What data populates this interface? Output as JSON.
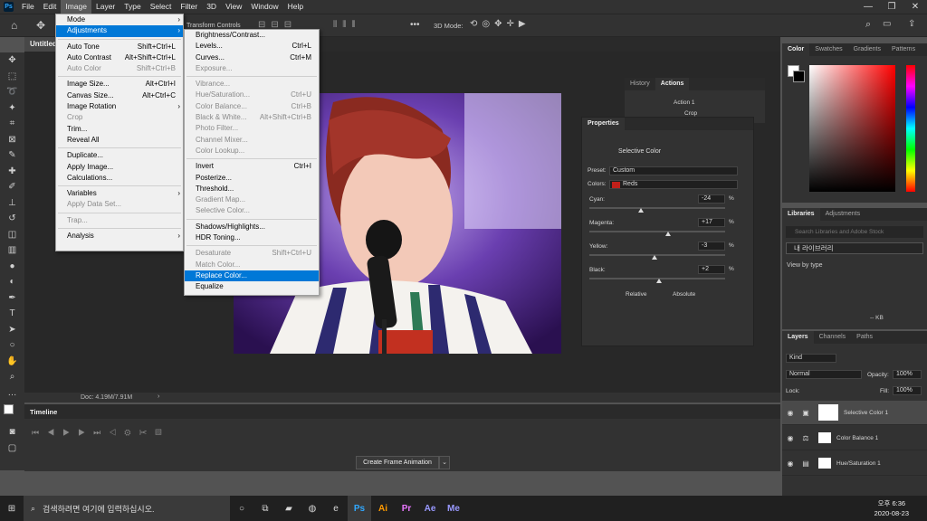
{
  "app": {
    "logo": "Ps"
  },
  "menubar": [
    "File",
    "Edit",
    "Image",
    "Layer",
    "Type",
    "Select",
    "Filter",
    "3D",
    "View",
    "Window",
    "Help"
  ],
  "window_controls": [
    "—",
    "❐",
    "✕"
  ],
  "options_bar": {
    "transform_label": "Transform Controls",
    "mode_3d": "3D Mode:",
    "dots": "•••"
  },
  "document": {
    "tab": "Untitled",
    "status": "Doc: 4.19M/7.91M"
  },
  "image_menu": [
    {
      "label": "Mode",
      "arrow": "›"
    },
    {
      "label": "Adjustments",
      "arrow": "›",
      "hl": true
    },
    {
      "sep": true
    },
    {
      "label": "Auto Tone",
      "sc": "Shift+Ctrl+L"
    },
    {
      "label": "Auto Contrast",
      "sc": "Alt+Shift+Ctrl+L"
    },
    {
      "label": "Auto Color",
      "sc": "Shift+Ctrl+B",
      "dis": true
    },
    {
      "sep": true
    },
    {
      "label": "Image Size...",
      "sc": "Alt+Ctrl+I"
    },
    {
      "label": "Canvas Size...",
      "sc": "Alt+Ctrl+C"
    },
    {
      "label": "Image Rotation",
      "arrow": "›"
    },
    {
      "label": "Crop",
      "dis": true
    },
    {
      "label": "Trim..."
    },
    {
      "label": "Reveal All"
    },
    {
      "sep": true
    },
    {
      "label": "Duplicate..."
    },
    {
      "label": "Apply Image..."
    },
    {
      "label": "Calculations..."
    },
    {
      "sep": true
    },
    {
      "label": "Variables",
      "arrow": "›"
    },
    {
      "label": "Apply Data Set...",
      "dis": true
    },
    {
      "sep": true
    },
    {
      "label": "Trap...",
      "dis": true
    },
    {
      "sep": true
    },
    {
      "label": "Analysis",
      "arrow": "›"
    }
  ],
  "adjust_menu": [
    {
      "label": "Brightness/Contrast..."
    },
    {
      "label": "Levels...",
      "sc": "Ctrl+L"
    },
    {
      "label": "Curves...",
      "sc": "Ctrl+M"
    },
    {
      "label": "Exposure...",
      "dis": true
    },
    {
      "sep": true
    },
    {
      "label": "Vibrance...",
      "dis": true
    },
    {
      "label": "Hue/Saturation...",
      "sc": "Ctrl+U",
      "dis": true
    },
    {
      "label": "Color Balance...",
      "sc": "Ctrl+B",
      "dis": true
    },
    {
      "label": "Black & White...",
      "sc": "Alt+Shift+Ctrl+B",
      "dis": true
    },
    {
      "label": "Photo Filter...",
      "dis": true
    },
    {
      "label": "Channel Mixer...",
      "dis": true
    },
    {
      "label": "Color Lookup...",
      "dis": true
    },
    {
      "sep": true
    },
    {
      "label": "Invert",
      "sc": "Ctrl+I"
    },
    {
      "label": "Posterize..."
    },
    {
      "label": "Threshold..."
    },
    {
      "label": "Gradient Map...",
      "dis": true
    },
    {
      "label": "Selective Color...",
      "dis": true
    },
    {
      "sep": true
    },
    {
      "label": "Shadows/Highlights..."
    },
    {
      "label": "HDR Toning..."
    },
    {
      "sep": true
    },
    {
      "label": "Desaturate",
      "sc": "Shift+Ctrl+U",
      "dis": true
    },
    {
      "label": "Match Color...",
      "dis": true
    },
    {
      "label": "Replace Color...",
      "hl": true
    },
    {
      "label": "Equalize"
    }
  ],
  "history_panel": {
    "tabs": [
      "History",
      "Actions"
    ],
    "items": [
      "Action 1",
      "Crop"
    ]
  },
  "properties": {
    "tab": "Properties",
    "title": "Selective Color",
    "preset_label": "Preset:",
    "preset": "Custom",
    "colors_label": "Colors:",
    "colors": "Reds",
    "colors_swatch": "#c0201a",
    "sliders": [
      {
        "label": "Cyan:",
        "value": "-24",
        "pct": "%",
        "pos": 0.38
      },
      {
        "label": "Magenta:",
        "value": "+17",
        "pct": "%",
        "pos": 0.58
      },
      {
        "label": "Yellow:",
        "value": "-3",
        "pct": "%",
        "pos": 0.48
      },
      {
        "label": "Black:",
        "value": "+2",
        "pct": "%",
        "pos": 0.51
      }
    ],
    "relative": "Relative",
    "absolute": "Absolute"
  },
  "color_panel": {
    "tabs": [
      "Color",
      "Swatches",
      "Gradients",
      "Patterns"
    ]
  },
  "libraries": {
    "tabs": [
      "Libraries",
      "Adjustments"
    ],
    "search": "Search Libraries and Adobe Stock",
    "library": "내 라이브러리",
    "view": "View by type",
    "size": "-- KB"
  },
  "layers_panel": {
    "tabs": [
      "Layers",
      "Channels",
      "Paths"
    ],
    "kind": "Kind",
    "blend": "Normal",
    "opacity_label": "Opacity:",
    "opacity": "100%",
    "lock_label": "Lock:",
    "fill_label": "Fill:",
    "fill": "100%",
    "layers": [
      {
        "name": "Selective Color 1",
        "icon": "▣",
        "sel": true
      },
      {
        "name": "Color Balance 1",
        "icon": "⚖"
      },
      {
        "name": "Hue/Saturation 1",
        "icon": "▤"
      }
    ]
  },
  "timeline": {
    "title": "Timeline",
    "button": "Create Frame Animation"
  },
  "taskbar": {
    "search": "검색하려면 여기에 입력하십시오.",
    "time": "오후 6:36",
    "date": "2020-08-23",
    "apps": [
      "Ps",
      "Ai",
      "Pr",
      "Ae",
      "Me"
    ]
  },
  "colors": {
    "accent": "#0078d7",
    "panel": "#323232",
    "canvas": "#282828"
  }
}
